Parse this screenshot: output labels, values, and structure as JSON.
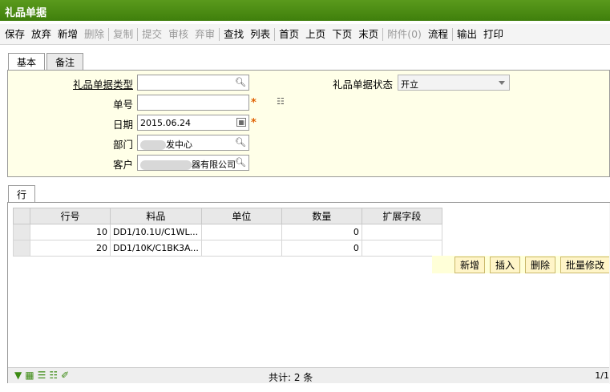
{
  "window": {
    "title": "礼品单据"
  },
  "toolbar": [
    {
      "label": "保存",
      "enabled": true
    },
    {
      "label": "放弃",
      "enabled": true
    },
    {
      "label": "新增",
      "enabled": true
    },
    {
      "label": "删除",
      "enabled": false
    },
    {
      "sep": true
    },
    {
      "label": "复制",
      "enabled": false
    },
    {
      "sep": true
    },
    {
      "label": "提交",
      "enabled": false
    },
    {
      "label": "审核",
      "enabled": false
    },
    {
      "label": "弃审",
      "enabled": false
    },
    {
      "sep": true
    },
    {
      "label": "查找",
      "enabled": true
    },
    {
      "label": "列表",
      "enabled": true
    },
    {
      "sep": true
    },
    {
      "label": "首页",
      "enabled": true
    },
    {
      "label": "上页",
      "enabled": true
    },
    {
      "label": "下页",
      "enabled": true
    },
    {
      "label": "末页",
      "enabled": true
    },
    {
      "sep": true
    },
    {
      "label": "附件(0)",
      "enabled": false
    },
    {
      "label": "流程",
      "enabled": true
    },
    {
      "sep": true
    },
    {
      "label": "输出",
      "enabled": true
    },
    {
      "label": "打印",
      "enabled": true
    }
  ],
  "tabs": {
    "basic": "基本",
    "remark": "备注"
  },
  "form": {
    "gift_type_label": "礼品单据类型",
    "gift_type_value": "",
    "status_label": "礼品单据状态",
    "status_value": "开立",
    "doc_no_label": "单号",
    "doc_no_value": "",
    "date_label": "日期",
    "date_value": "2015.06.24",
    "dept_label": "部门",
    "dept_value_visible": "发中心",
    "customer_label": "客户",
    "customer_value_visible": "器有限公司",
    "required_mark": "*"
  },
  "lines_tab": {
    "label": "行"
  },
  "grid": {
    "columns": [
      "行号",
      "料品",
      "单位",
      "数量",
      "扩展字段"
    ],
    "rows": [
      {
        "line_no": "10",
        "item": "DD1/10.1U/C1WL...",
        "unit": "",
        "qty": "0",
        "ext": ""
      },
      {
        "line_no": "20",
        "item": "DD1/10K/C1BK3A...",
        "unit": "",
        "qty": "0",
        "ext": ""
      }
    ]
  },
  "grid_actions": {
    "add": "新增",
    "insert": "插入",
    "delete": "删除",
    "batch_edit": "批量修改"
  },
  "status": {
    "total": "共计: 2 条",
    "page": "1/1"
  },
  "colors": {
    "title_bg": "#4a8a14",
    "form_bg": "#ffffe8",
    "required": "#e06000"
  }
}
